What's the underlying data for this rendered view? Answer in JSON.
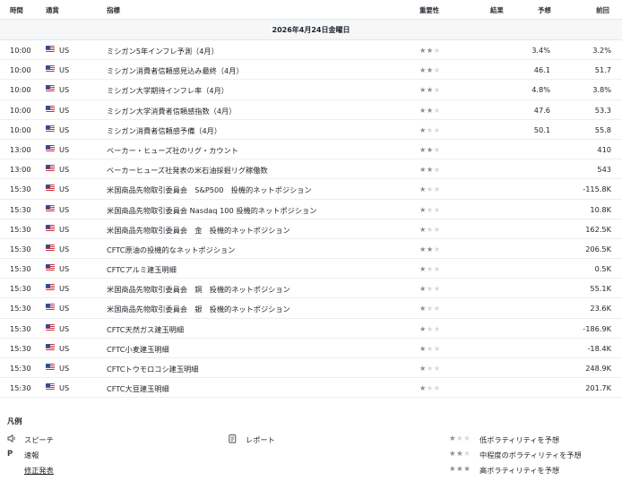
{
  "columns": {
    "time": "時間",
    "currency": "通貨",
    "indicator": "指標",
    "importance": "重要性",
    "actual": "結果",
    "forecast": "予想",
    "previous": "前回"
  },
  "date_header": "2026年4月24日金曜日",
  "rows": [
    {
      "time": "10:00",
      "currency": "US",
      "name": "ミシガン5年インフレ予測（4月）",
      "stars": 2,
      "actual": "",
      "forecast": "3.4%",
      "previous": "3.2%"
    },
    {
      "time": "10:00",
      "currency": "US",
      "name": "ミシガン消費者信頼感見込み最終（4月）",
      "stars": 2,
      "actual": "",
      "forecast": "46.1",
      "previous": "51.7"
    },
    {
      "time": "10:00",
      "currency": "US",
      "name": "ミシガン大学期待インフレ率（4月）",
      "stars": 2,
      "actual": "",
      "forecast": "4.8%",
      "previous": "3.8%"
    },
    {
      "time": "10:00",
      "currency": "US",
      "name": "ミシガン大学消費者信頼感指数（4月）",
      "stars": 2,
      "actual": "",
      "forecast": "47.6",
      "previous": "53.3"
    },
    {
      "time": "10:00",
      "currency": "US",
      "name": "ミシガン消費者信頼感予備（4月）",
      "stars": 1,
      "actual": "",
      "forecast": "50.1",
      "previous": "55.8"
    },
    {
      "time": "13:00",
      "currency": "US",
      "name": "ベーカー・ヒューズ社のリグ・カウント",
      "stars": 2,
      "actual": "",
      "forecast": "",
      "previous": "410"
    },
    {
      "time": "13:00",
      "currency": "US",
      "name": "ベーカーヒューズ社発表の米石油採掘リグ稼働数",
      "stars": 2,
      "actual": "",
      "forecast": "",
      "previous": "543"
    },
    {
      "time": "15:30",
      "currency": "US",
      "name": "米国商品先物取引委員会　S&P500　投機的ネットポジション",
      "stars": 1,
      "actual": "",
      "forecast": "",
      "previous": "-115.8K"
    },
    {
      "time": "15:30",
      "currency": "US",
      "name": "米国商品先物取引委員会 Nasdaq 100 投機的ネットポジション",
      "stars": 1,
      "actual": "",
      "forecast": "",
      "previous": "10.8K"
    },
    {
      "time": "15:30",
      "currency": "US",
      "name": "米国商品先物取引委員会　金　投機的ネットポジション",
      "stars": 1,
      "actual": "",
      "forecast": "",
      "previous": "162.5K"
    },
    {
      "time": "15:30",
      "currency": "US",
      "name": "CFTC原油の投機的なネットポジション",
      "stars": 2,
      "actual": "",
      "forecast": "",
      "previous": "206.5K"
    },
    {
      "time": "15:30",
      "currency": "US",
      "name": "CFTCアルミ建玉明細",
      "stars": 1,
      "actual": "",
      "forecast": "",
      "previous": "0.5K"
    },
    {
      "time": "15:30",
      "currency": "US",
      "name": "米国商品先物取引委員会　銅　投機的ネットポジション",
      "stars": 1,
      "actual": "",
      "forecast": "",
      "previous": "55.1K"
    },
    {
      "time": "15:30",
      "currency": "US",
      "name": "米国商品先物取引委員会　銀　投機的ネットポジション",
      "stars": 1,
      "actual": "",
      "forecast": "",
      "previous": "23.6K"
    },
    {
      "time": "15:30",
      "currency": "US",
      "name": "CFTC天然ガス建玉明細",
      "stars": 1,
      "actual": "",
      "forecast": "",
      "previous": "-186.9K"
    },
    {
      "time": "15:30",
      "currency": "US",
      "name": "CFTC小麦建玉明細",
      "stars": 1,
      "actual": "",
      "forecast": "",
      "previous": "-18.4K"
    },
    {
      "time": "15:30",
      "currency": "US",
      "name": "CFTCトウモロコシ建玉明細",
      "stars": 1,
      "actual": "",
      "forecast": "",
      "previous": "248.9K"
    },
    {
      "time": "15:30",
      "currency": "US",
      "name": "CFTC大豆建玉明細",
      "stars": 1,
      "actual": "",
      "forecast": "",
      "previous": "201.7K"
    }
  ],
  "legend": {
    "title": "凡例",
    "speech": "スピーチ",
    "preliminary": "速報",
    "preliminary_icon": "P",
    "revised": "修正発表",
    "report": "レポート",
    "low": "低ボラティリティを予想",
    "mid": "中程度のボラティリティを予想",
    "high": "高ボラティリティを予想",
    "speech_icon_name": "speaker-icon",
    "report_icon_name": "document-icon"
  },
  "colors": {
    "star_on": "#8a8f98",
    "star_off": "#d5d8dd",
    "date_bg": "#f6f7f9"
  }
}
